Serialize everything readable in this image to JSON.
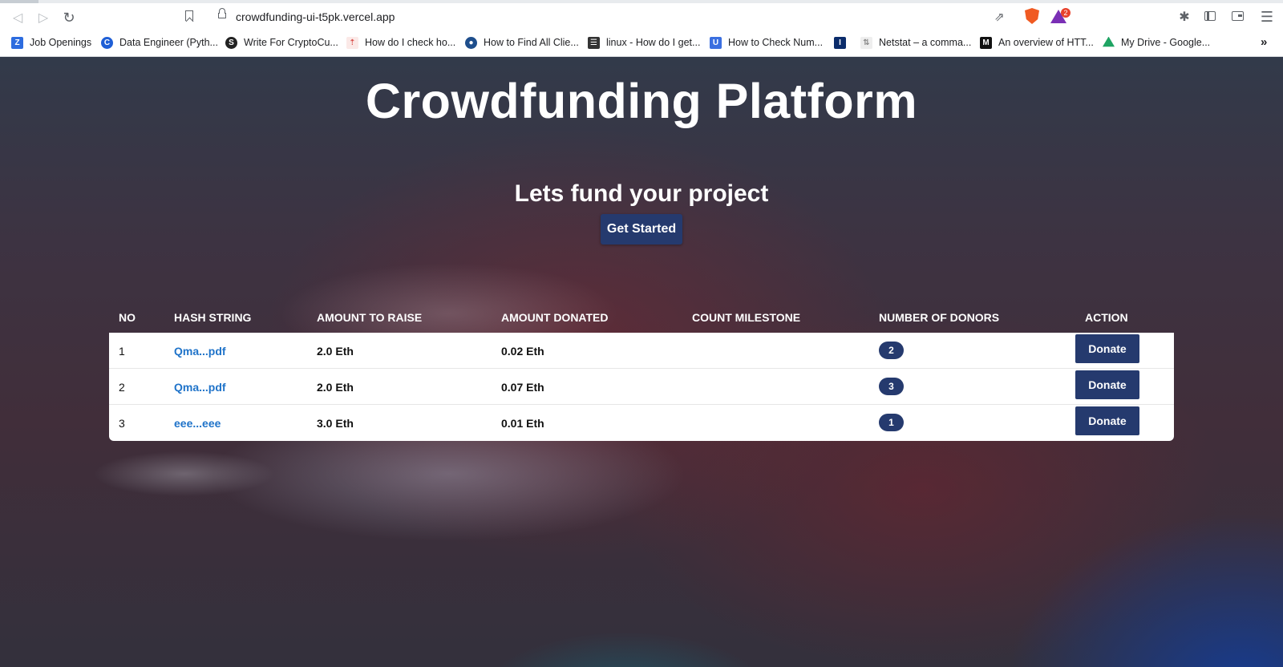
{
  "browser": {
    "url": "crowdfunding-ui-t5pk.vercel.app",
    "rewards_count": "2",
    "bookmarks": [
      {
        "label": "Job Openings",
        "icon": "zoho-z-icon",
        "color": "#2d6cdf"
      },
      {
        "label": "Data Engineer (Pyth...",
        "icon": "circle-c-icon",
        "color": "#1f5fd6"
      },
      {
        "label": "Write For CryptoCu...",
        "icon": "crypto-icon",
        "color": "#222222"
      },
      {
        "label": "How do I check ho...",
        "icon": "site-icon",
        "color": "#d9534f"
      },
      {
        "label": "How to Find All Clie...",
        "icon": "globe-icon",
        "color": "#1e4e8c"
      },
      {
        "label": "linux - How do I get...",
        "icon": "stack-icon",
        "color": "#333333"
      },
      {
        "label": "How to Check Num...",
        "icon": "u-icon",
        "color": "#3b6fe0"
      },
      {
        "label": "",
        "icon": "i-icon",
        "color": "#0b2c6b"
      },
      {
        "label": "Netstat – a comma...",
        "icon": "netstat-icon",
        "color": "#888888"
      },
      {
        "label": "An overview of HTT...",
        "icon": "m-icon",
        "color": "#111111"
      },
      {
        "label": "My Drive - Google...",
        "icon": "drive-icon",
        "color": "#1fa463"
      }
    ]
  },
  "hero": {
    "title": "Crowdfunding Platform",
    "subtitle": "Lets fund your project",
    "cta_label": "Get Started"
  },
  "table": {
    "headers": {
      "no": "NO",
      "hash": "HASH STRING",
      "amount_to_raise": "AMOUNT TO RAISE",
      "amount_donated": "AMOUNT DONATED",
      "count_milestone": "COUNT MILESTONE",
      "donors": "NUMBER OF DONORS",
      "action": "ACTION"
    },
    "rows": [
      {
        "no": "1",
        "hash": "Qma...pdf",
        "amount_to_raise": "2.0 Eth",
        "amount_donated": "0.02 Eth",
        "count_milestone": "",
        "donors": "2",
        "action": "Donate"
      },
      {
        "no": "2",
        "hash": "Qma...pdf",
        "amount_to_raise": "2.0 Eth",
        "amount_donated": "0.07 Eth",
        "count_milestone": "",
        "donors": "3",
        "action": "Donate"
      },
      {
        "no": "3",
        "hash": "eee...eee",
        "amount_to_raise": "3.0 Eth",
        "amount_donated": "0.01 Eth",
        "count_milestone": "",
        "donors": "1",
        "action": "Donate"
      }
    ]
  },
  "colors": {
    "primary_button": "#253a6e",
    "link": "#1f73c9"
  }
}
